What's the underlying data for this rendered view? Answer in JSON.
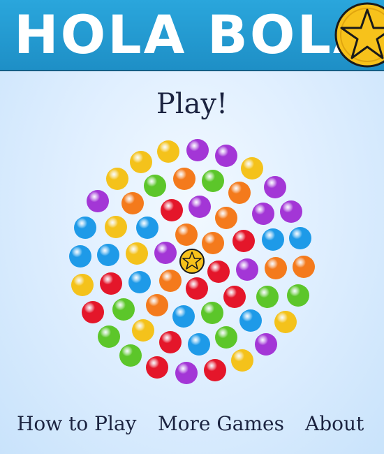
{
  "header": {
    "title": "HOLA BOLA!",
    "logo_icon": "star-icon",
    "colors": {
      "bar": "#1e8fc6",
      "star_fill": "#f7c21b",
      "outline": "#1a1a1a"
    }
  },
  "play": {
    "label": "Play!"
  },
  "board": {
    "center_icon": "star-icon",
    "ball_colors": {
      "yellow": "#f4c21b",
      "purple": "#a336d6",
      "orange": "#f47a1c",
      "green": "#5cc62a",
      "red": "#e4162a",
      "blue": "#1e9ae8"
    },
    "balls": [
      {
        "c": "yellow"
      },
      {
        "c": "purple"
      },
      {
        "c": "purple"
      },
      {
        "c": "yellow"
      },
      {
        "c": "yellow"
      },
      {
        "c": "yellow"
      },
      {
        "c": "orange"
      },
      {
        "c": "green"
      },
      {
        "c": "purple"
      },
      {
        "c": "purple"
      },
      {
        "c": "green"
      },
      {
        "c": "orange"
      },
      {
        "c": "orange"
      },
      {
        "c": "purple"
      },
      {
        "c": "red"
      },
      {
        "c": "purple"
      },
      {
        "c": "orange"
      },
      {
        "c": "purple"
      },
      {
        "c": "blue"
      },
      {
        "c": "yellow"
      },
      {
        "c": "blue"
      },
      {
        "c": "red"
      },
      {
        "c": "blue"
      },
      {
        "c": "blue"
      },
      {
        "c": "blue"
      },
      {
        "c": "blue"
      },
      {
        "c": "yellow"
      },
      {
        "c": "purple"
      },
      {
        "c": "orange"
      },
      {
        "c": "orange"
      },
      {
        "c": "yellow"
      },
      {
        "c": "red"
      },
      {
        "c": "blue"
      },
      {
        "c": "orange"
      },
      {
        "c": "red"
      },
      {
        "c": "purple"
      },
      {
        "c": "orange"
      },
      {
        "c": "orange"
      },
      {
        "c": "red"
      },
      {
        "c": "red"
      },
      {
        "c": "green"
      },
      {
        "c": "red"
      },
      {
        "c": "green"
      },
      {
        "c": "orange"
      },
      {
        "c": "blue"
      },
      {
        "c": "green"
      },
      {
        "c": "blue"
      },
      {
        "c": "green"
      },
      {
        "c": "green"
      },
      {
        "c": "yellow"
      },
      {
        "c": "green"
      },
      {
        "c": "yellow"
      },
      {
        "c": "green"
      },
      {
        "c": "red"
      },
      {
        "c": "blue"
      },
      {
        "c": "purple"
      },
      {
        "c": "red"
      },
      {
        "c": "purple"
      },
      {
        "c": "red"
      },
      {
        "c": "yellow"
      },
      {
        "c": "green"
      },
      {
        "c": "green"
      }
    ]
  },
  "footer": {
    "how_to_play": "How to Play",
    "more_games": "More Games",
    "about": "About"
  }
}
